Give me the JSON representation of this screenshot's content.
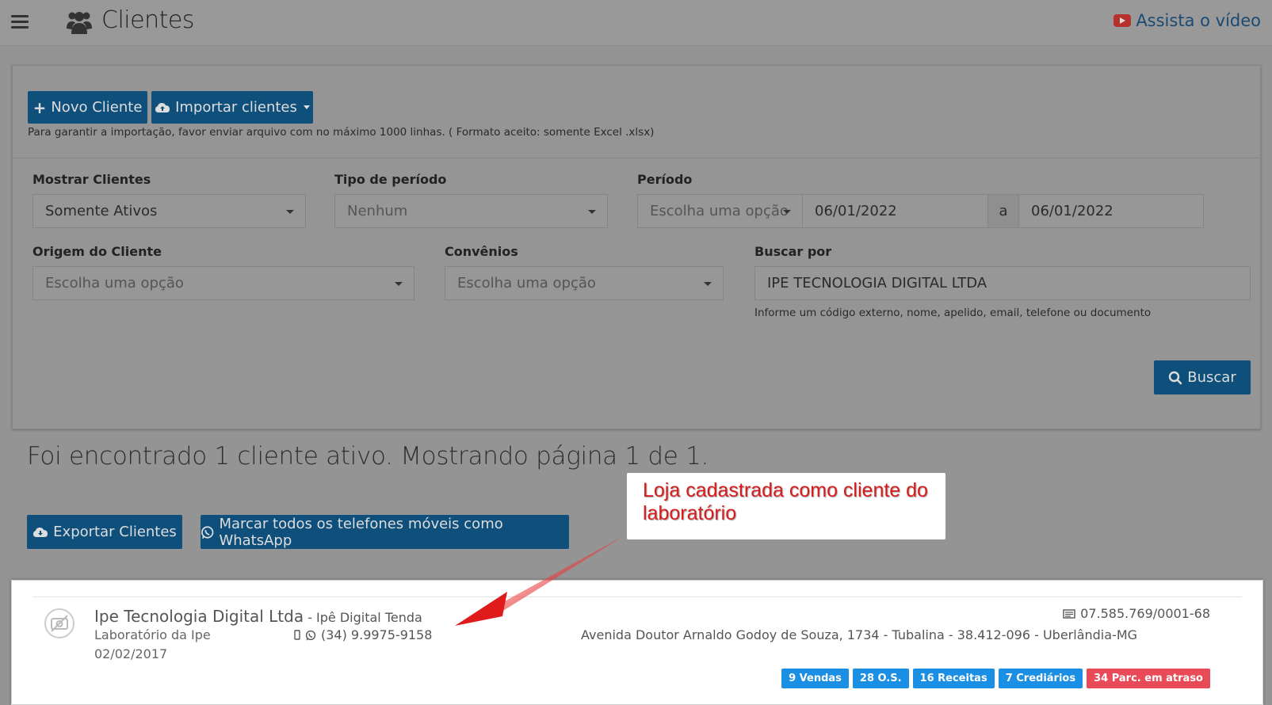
{
  "header": {
    "title": "Clientes",
    "video_link": "Assista o vídeo"
  },
  "toolbar": {
    "new_client": "Novo Cliente",
    "import_clients": "Importar clientes",
    "import_hint": "Para garantir a importação, favor enviar arquivo com no máximo 1000 linhas. ( Formato aceito: somente Excel .xlsx)"
  },
  "filters": {
    "show_clients": {
      "label": "Mostrar Clientes",
      "value": "Somente Ativos"
    },
    "period_type": {
      "label": "Tipo de período",
      "value": "Nenhum"
    },
    "period": {
      "label": "Período",
      "value": "Escolha uma opção",
      "start": "06/01/2022",
      "separator": "a",
      "end": "06/01/2022"
    },
    "origin": {
      "label": "Origem do Cliente",
      "placeholder": "Escolha uma opção"
    },
    "agreements": {
      "label": "Convênios",
      "placeholder": "Escolha uma opção"
    },
    "search": {
      "label": "Buscar por",
      "value": "IPE TECNOLOGIA DIGITAL LTDA",
      "help": "Informe um código externo, nome, apelido, email, telefone ou documento"
    },
    "search_button": "Buscar"
  },
  "results": {
    "summary": "Foi encontrado 1 cliente ativo. Mostrando página 1 de 1.",
    "export_button": "Exportar Clientes",
    "whatsapp_button": "Marcar todos os telefones móveis como WhatsApp"
  },
  "callout": {
    "text": "Loja cadastrada como cliente do laboratório"
  },
  "client": {
    "name": "Ipe Tecnologia Digital Ltda",
    "nickname": " - Ipê Digital Tenda",
    "origin": "Laboratório da Ipe",
    "date": "02/02/2017",
    "phone": "(34) 9.9975-9158",
    "document": "07.585.769/0001-68",
    "address": "Avenida Doutor Arnaldo Godoy de Souza, 1734 - Tubalina - 38.412-096 - Uberlândia-MG",
    "badges": [
      {
        "label": "9 Vendas",
        "color": "#1a8fe3"
      },
      {
        "label": "28 O.S.",
        "color": "#1a8fe3"
      },
      {
        "label": "16 Receitas",
        "color": "#1a8fe3"
      },
      {
        "label": "7 Crediários",
        "color": "#1a8fe3"
      },
      {
        "label": "34 Parc. em atraso",
        "color": "#e84b57"
      }
    ]
  }
}
